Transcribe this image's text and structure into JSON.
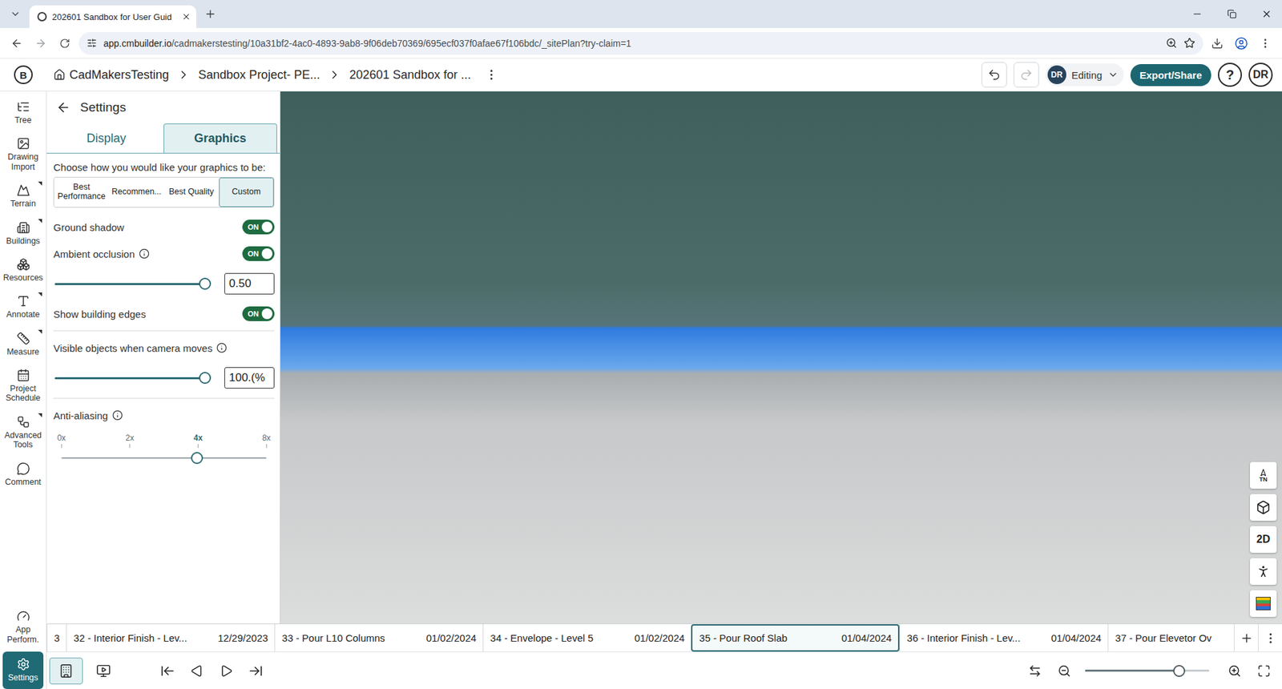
{
  "browser": {
    "tab": {
      "title": "202601 Sandbox for User Guid",
      "selected": true
    },
    "url": {
      "host": "app.cmbuilder.io",
      "path": "/cadmakerstesting/10a31bf2-4ac0-4893-9ab8-9f06deb70369/695ecf037f0afae67f106bdc/_sitePlan?try-claim=1"
    }
  },
  "app_header": {
    "logo": "B",
    "breadcrumbs": [
      "CadMakersTesting",
      "Sandbox Project- PE...",
      "202601 Sandbox for ..."
    ],
    "mode": {
      "avatar": "DR",
      "label": "Editing"
    },
    "export_button": "Export/Share",
    "help": "?",
    "user": "DR"
  },
  "rail": {
    "items": [
      {
        "label": "Tree",
        "submenu": false,
        "selected": false
      },
      {
        "label": "Drawing Import",
        "submenu": false,
        "selected": false
      },
      {
        "label": "Terrain",
        "submenu": true,
        "selected": false
      },
      {
        "label": "Buildings",
        "submenu": true,
        "selected": false
      },
      {
        "label": "Resources",
        "submenu": false,
        "selected": false
      },
      {
        "label": "Annotate",
        "submenu": true,
        "selected": false
      },
      {
        "label": "Measure",
        "submenu": true,
        "selected": false
      },
      {
        "label": "Project Schedule",
        "submenu": false,
        "selected": false
      },
      {
        "label": "Advanced Tools",
        "submenu": true,
        "selected": false
      },
      {
        "label": "Comment",
        "submenu": false,
        "selected": false
      }
    ],
    "bottom_items": [
      {
        "label": "App Perform.",
        "selected": false
      },
      {
        "label": "Settings",
        "selected": true
      }
    ]
  },
  "settings_panel": {
    "title": "Settings",
    "tabs": [
      {
        "label": "Display",
        "selected": false
      },
      {
        "label": "Graphics",
        "selected": true
      }
    ],
    "prompt": "Choose how you would like your graphics to be:",
    "presets": [
      {
        "label": "Best Performance",
        "selected": false
      },
      {
        "label": "Recommen...",
        "selected": false
      },
      {
        "label": "Best Quality",
        "selected": false
      },
      {
        "label": "Custom",
        "selected": true
      }
    ],
    "options": [
      {
        "kind": "toggle",
        "label": "Ground shadow",
        "on": true,
        "badge": "ON",
        "info": false
      },
      {
        "kind": "toggle",
        "label": "Ambient occlusion",
        "on": true,
        "badge": "ON",
        "info": true
      },
      {
        "kind": "slider",
        "level": 1.0,
        "value": "0.50"
      },
      {
        "kind": "toggle",
        "label": "Show building edges",
        "on": true,
        "badge": "ON",
        "info": false
      },
      {
        "kind": "divider"
      },
      {
        "kind": "label",
        "label": "Visible objects when camera moves",
        "info": true
      },
      {
        "kind": "slider",
        "level": 1.0,
        "value": "100.(%"
      },
      {
        "kind": "divider"
      },
      {
        "kind": "label",
        "label": "Anti-aliasing",
        "info": true
      },
      {
        "kind": "ticks",
        "level": 0.66,
        "ticks": [
          {
            "label": "0x",
            "selected": false
          },
          {
            "label": "2x",
            "selected": false
          },
          {
            "label": "4x",
            "selected": true
          },
          {
            "label": "8x",
            "selected": false
          }
        ]
      }
    ]
  },
  "viewport": {
    "controls": [
      {
        "kind": "compass",
        "label": "TN"
      },
      {
        "kind": "cube"
      },
      {
        "kind": "text",
        "label": "2D"
      },
      {
        "kind": "person"
      },
      {
        "kind": "layers"
      }
    ]
  },
  "timeline": {
    "items": [
      {
        "label": "3",
        "selected": false
      },
      {
        "label": "32 - Interior Finish - Lev...",
        "date": "12/29/2023",
        "selected": false
      },
      {
        "label": "33 - Pour L10 Columns",
        "date": "01/02/2024",
        "selected": false
      },
      {
        "label": "34 - Envelope - Level 5",
        "date": "01/02/2024",
        "selected": false
      },
      {
        "label": "35 - Pour Roof Slab",
        "date": "01/04/2024",
        "selected": true
      },
      {
        "label": "36 - Interior Finish - Lev...",
        "date": "01/04/2024",
        "selected": false
      },
      {
        "label": "37 - Pour Elevetor Ov",
        "selected": false
      }
    ]
  },
  "bottom_bar": {
    "modes": [
      {
        "kind": "site",
        "selected": true
      },
      {
        "kind": "video",
        "selected": false
      }
    ],
    "zoom": {
      "level": 0.76
    }
  }
}
